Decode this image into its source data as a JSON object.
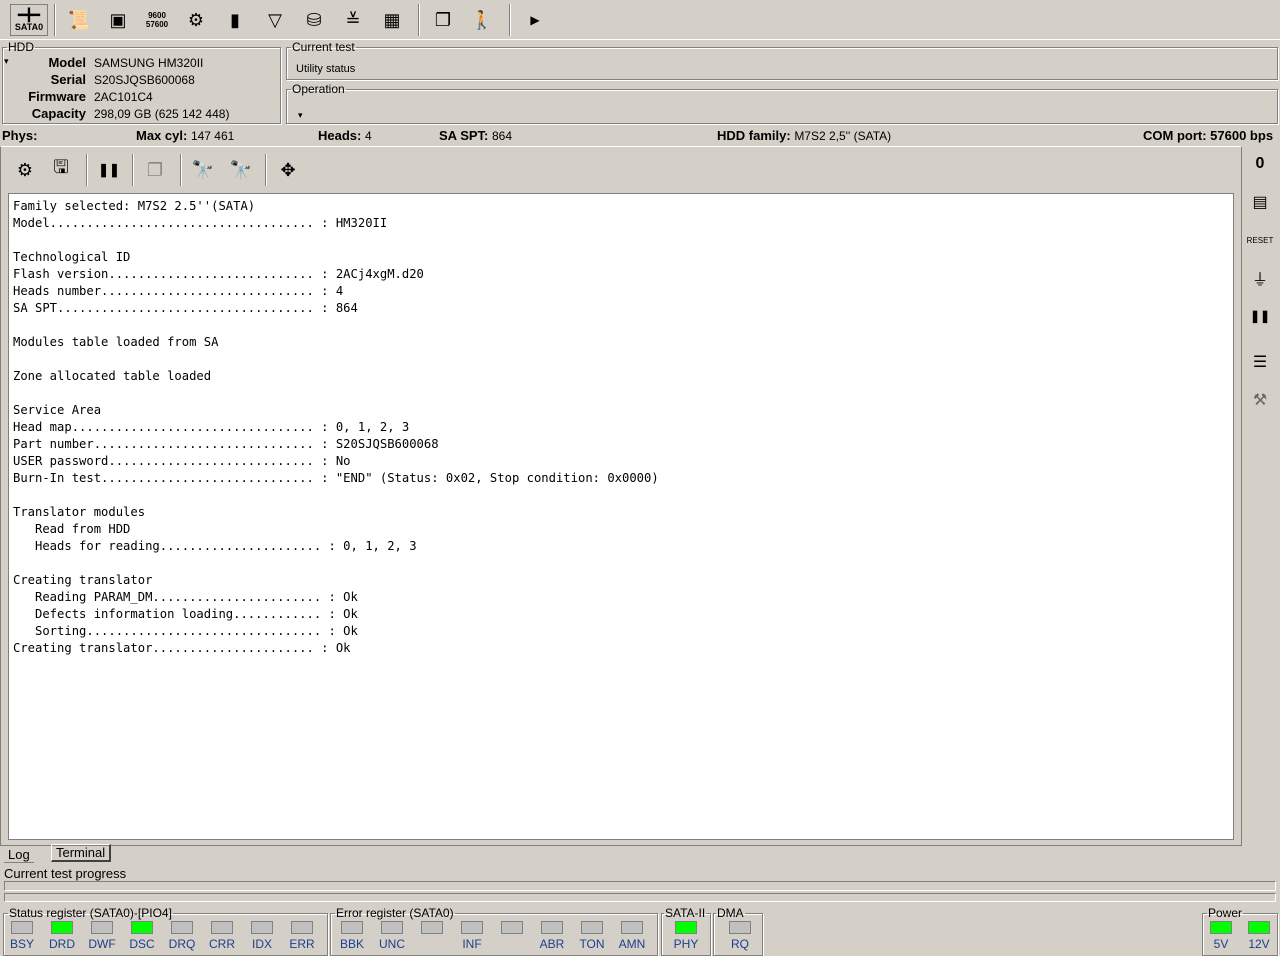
{
  "toolbar": {
    "port_label": "SATA0",
    "baud_top": "9600",
    "baud_bottom": "57600"
  },
  "hdd": {
    "legend": "HDD",
    "model_label": "Model",
    "model": "SAMSUNG HM320II",
    "serial_label": "Serial",
    "serial": "S20SJQSB600068",
    "firmware_label": "Firmware",
    "firmware": "2AC101C4",
    "capacity_label": "Capacity",
    "capacity": "298,09 GB (625 142 448)"
  },
  "current_test": {
    "legend": "Current test",
    "status": "Utility status"
  },
  "operation": {
    "legend": "Operation"
  },
  "phys": {
    "label": "Phys:",
    "maxcyl_label": "Max cyl:",
    "maxcyl": "147 461",
    "heads_label": "Heads:",
    "heads": "4",
    "saspt_label": "SA SPT:",
    "saspt": "864",
    "family_label": "HDD family:",
    "family": "M7S2 2,5'' (SATA)",
    "com_label": "COM port:",
    "com": "57600 bps"
  },
  "log": [
    "Family selected: M7S2 2.5''(SATA)",
    "Model.................................... : HM320II",
    "",
    "Technological ID",
    "Flash version............................ : 2ACj4xgM.d20",
    "Heads number............................. : 4",
    "SA SPT................................... : 864",
    "",
    "Modules table loaded from SA",
    "",
    "Zone allocated table loaded",
    "",
    "Service Area",
    "Head map................................. : 0, 1, 2, 3",
    "Part number.............................. : S20SJQSB600068",
    "USER password............................ : No",
    "Burn-In test............................. : \"END\" (Status: 0x02, Stop condition: 0x0000)",
    "",
    "Translator modules",
    "   Read from HDD",
    "   Heads for reading...................... : 0, 1, 2, 3",
    "",
    "Creating translator",
    "   Reading PARAM_DM....................... : Ok",
    "   Defects information loading............ : Ok",
    "   Sorting................................ : Ok",
    "Creating translator...................... : Ok"
  ],
  "tabs": {
    "log": "Log",
    "terminal": "Terminal"
  },
  "progress": {
    "label": "Current test progress",
    "value": 0
  },
  "status_reg": {
    "legend": "Status register (SATA0)-[PIO4]",
    "leds": [
      {
        "l": "BSY",
        "on": false
      },
      {
        "l": "DRD",
        "on": true
      },
      {
        "l": "DWF",
        "on": false
      },
      {
        "l": "DSC",
        "on": true
      },
      {
        "l": "DRQ",
        "on": false
      },
      {
        "l": "CRR",
        "on": false
      },
      {
        "l": "IDX",
        "on": false
      },
      {
        "l": "ERR",
        "on": false
      }
    ]
  },
  "error_reg": {
    "legend": "Error register (SATA0)",
    "leds": [
      {
        "l": "BBK",
        "on": false
      },
      {
        "l": "UNC",
        "on": false
      },
      {
        "l": "",
        "on": false
      },
      {
        "l": "INF",
        "on": false
      },
      {
        "l": "",
        "on": false
      },
      {
        "l": "ABR",
        "on": false
      },
      {
        "l": "TON",
        "on": false
      },
      {
        "l": "AMN",
        "on": false
      }
    ]
  },
  "sata2": {
    "legend": "SATA-II",
    "leds": [
      {
        "l": "PHY",
        "on": true
      }
    ]
  },
  "dma": {
    "legend": "DMA",
    "leds": [
      {
        "l": "RQ",
        "on": false
      }
    ]
  },
  "power": {
    "legend": "Power",
    "leds": [
      {
        "l": "5V",
        "on": true
      },
      {
        "l": "12V",
        "on": true
      }
    ]
  },
  "colors": {
    "led_on": "#00ff00",
    "led_off": "#c0c0c0",
    "label": "#1c3f8c"
  }
}
